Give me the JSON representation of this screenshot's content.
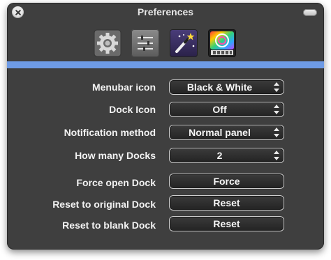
{
  "window": {
    "title": "Preferences"
  },
  "toolbar": {
    "icons": [
      "gear-icon",
      "sliders-icon",
      "magic-wand-icon",
      "dock-icon"
    ]
  },
  "settings": {
    "menubar_icon": {
      "label": "Menubar icon",
      "value": "Black & White"
    },
    "dock_icon": {
      "label": "Dock Icon",
      "value": "Off"
    },
    "notification_method": {
      "label": "Notification method",
      "value": "Normal panel"
    },
    "how_many_docks": {
      "label": "How many Docks",
      "value": "2"
    },
    "force_open_dock": {
      "label": "Force open Dock",
      "button": "Force"
    },
    "reset_original": {
      "label": "Reset to original Dock",
      "button": "Reset"
    },
    "reset_blank": {
      "label": "Reset to blank Dock",
      "button": "Reset"
    }
  },
  "colors": {
    "accent_bar": "#6e9be6",
    "window_bg": "#3f3f3f"
  }
}
